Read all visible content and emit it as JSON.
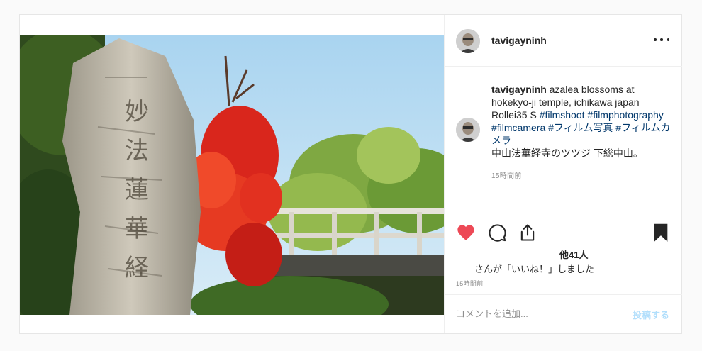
{
  "post": {
    "username": "tavigayninh",
    "caption": {
      "username": "tavigayninh",
      "text": " azalea blossoms at hokekyo-ji temple, ichikawa japan Rollei35 S ",
      "tags": [
        "#filmshoot",
        "#filmphotography",
        "#filmcamera",
        "#フィルム写真",
        "#フィルムカメラ"
      ],
      "line_jp": "中山法華経寺のツツジ 下総中山。",
      "time": "15時間前"
    },
    "likes": {
      "count": "他41人",
      "text": "さんが「いいね！」しました"
    },
    "time": "15時間前",
    "comment": {
      "placeholder": "コメントを追加...",
      "post_label": "投稿する"
    },
    "icons": {
      "heart": "heart-icon",
      "comment": "comment-icon",
      "share": "share-icon",
      "bookmark": "bookmark-icon",
      "more": "more-icon"
    },
    "colors": {
      "like": "#ed4956",
      "link": "#00376b",
      "post_button": "#b2dffc",
      "muted": "#8e8e8e"
    }
  }
}
